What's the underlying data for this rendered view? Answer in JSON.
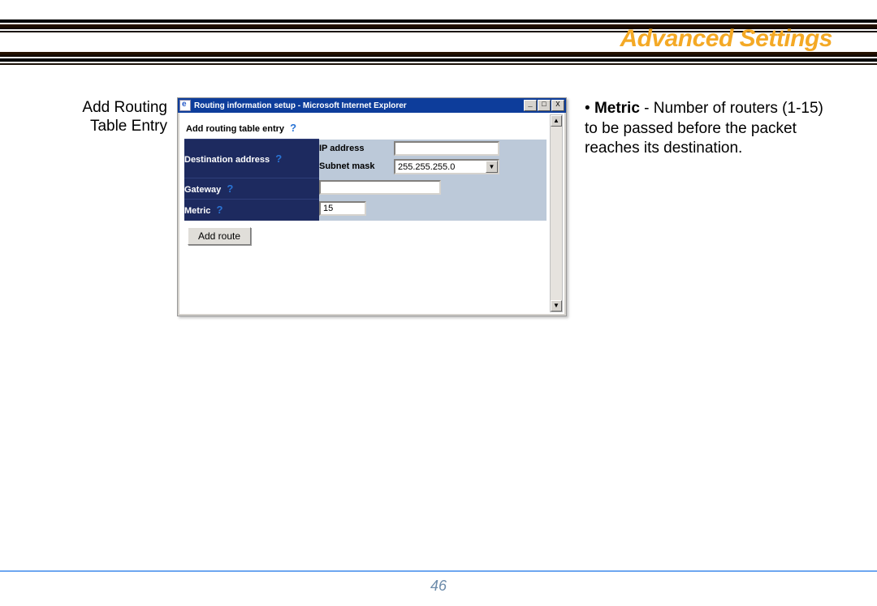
{
  "page_title": "Advanced Settings",
  "page_number": "46",
  "left_caption": {
    "line1": "Add Routing",
    "line2": "Table Entry"
  },
  "description": {
    "bullet": "•",
    "metric_label": "Metric",
    "tail": " - Number of routers (1-15) to be passed before the packet reaches its destination."
  },
  "window": {
    "title": "Routing information setup - Microsoft Internet Explorer",
    "min_glyph": "_",
    "max_glyph": "□",
    "close_glyph": "X",
    "scroll_up": "▲",
    "scroll_down": "▼"
  },
  "form": {
    "heading": "Add routing table entry",
    "help_glyph": "?",
    "dest_label": "Destination address",
    "ip_label": "IP address",
    "ip_value": "",
    "subnet_label": "Subnet mask",
    "subnet_value": "255.255.255.0",
    "subnet_btn": "▼",
    "gateway_label": "Gateway",
    "gateway_value": "",
    "metric_label": "Metric",
    "metric_value": "15",
    "add_route_btn": "Add route"
  }
}
